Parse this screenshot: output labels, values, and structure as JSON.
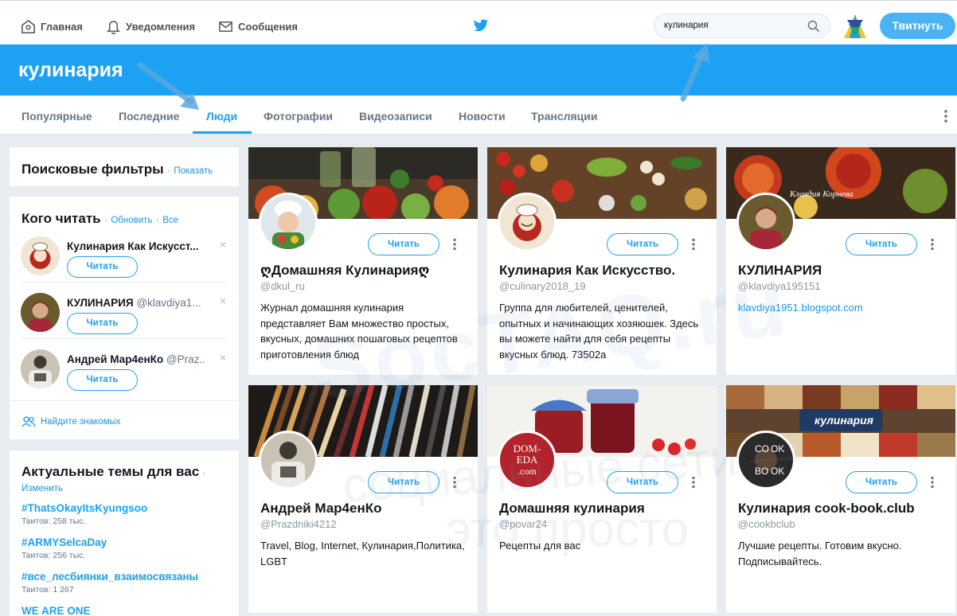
{
  "nav": {
    "home": "Главная",
    "notifications": "Уведомления",
    "messages": "Сообщения",
    "search_value": "кулинария",
    "tweet_button": "Твитнуть"
  },
  "banner": {
    "title": "кулинария"
  },
  "tabs": [
    {
      "label": "Популярные"
    },
    {
      "label": "Последние"
    },
    {
      "label": "Люди"
    },
    {
      "label": "Фотографии"
    },
    {
      "label": "Видеозаписи"
    },
    {
      "label": "Новости"
    },
    {
      "label": "Трансляции"
    }
  ],
  "filters": {
    "title": "Поисковые фильтры",
    "dot": "·",
    "show": "Показать"
  },
  "who_to_follow": {
    "title": "Кого читать",
    "dot": "·",
    "refresh": "Обновить",
    "all": "Все",
    "items": [
      {
        "name": "Кулинария Как Искусст...",
        "handle": "",
        "button": "Читать"
      },
      {
        "name": "КУЛИНАРИЯ",
        "handle": "@klavdiya1...",
        "button": "Читать"
      },
      {
        "name": "Андрей Мар4енКо",
        "handle": "@Praz...",
        "button": "Читать"
      }
    ],
    "find_friends": "Найдите знакомых"
  },
  "trends": {
    "title": "Актуальные темы для вас",
    "dot": "·",
    "change": "Изменить",
    "items": [
      {
        "tag": "#ThatsOkayItsKyungsoo",
        "count": "Твитов: 258 тыс."
      },
      {
        "tag": "#ARMYSelcaDay",
        "count": "Твитов: 256 тыс."
      },
      {
        "tag": "#все_лесбиянки_взаимосвязаны",
        "count": "Твитов: 1 267"
      },
      {
        "tag": "WE ARE ONE",
        "count": ""
      }
    ]
  },
  "people": [
    {
      "name": "ღДомашняя Кулинарияღ",
      "handle": "@dkul_ru",
      "bio": "Журнал домашняя кулинария представляет Вам множество простых, вкусных, домашних пошаговых рецептов приготовления блюд",
      "follow": "Читать"
    },
    {
      "name": "Кулинария Как Искусство.",
      "handle": "@culinary2018_19",
      "bio": "Группа для любителей, ценителей, опытных и начинающих хозяюшек. Здесь вы можете найти для себя рецепты вкусных блюд. 73502a",
      "follow": "Читать"
    },
    {
      "name": "КУЛИНАРИЯ",
      "handle": "@klavdiya195151",
      "bio": "klavdiya1951.blogspot.com",
      "follow": "Читать",
      "cover_text": "Клавдия Корнева"
    },
    {
      "name": "Андрей Мар4енКо",
      "handle": "@Prazdniki4212",
      "bio": "Travel, Blog, Internet, Кулинария,Политика, LGBT",
      "follow": "Читать"
    },
    {
      "name": "Домашняя кулинария",
      "handle": "@povar24",
      "bio": "Рецепты для вас",
      "follow": "Читать",
      "avatar_text": [
        "DOM-",
        "EDA",
        ".com"
      ]
    },
    {
      "name": "Кулинария cook-book.club",
      "handle": "@cookbclub",
      "bio": "Лучшие рецепты. Готовим вкусно. Подписывайтесь.",
      "follow": "Читать",
      "cover_text": "кулинария",
      "avatar_text": [
        "CO",
        "OK",
        "BO",
        "OK"
      ]
    }
  ],
  "watermark": [
    "SocTAQ.ru",
    "социальные сети —",
    "это просто"
  ]
}
